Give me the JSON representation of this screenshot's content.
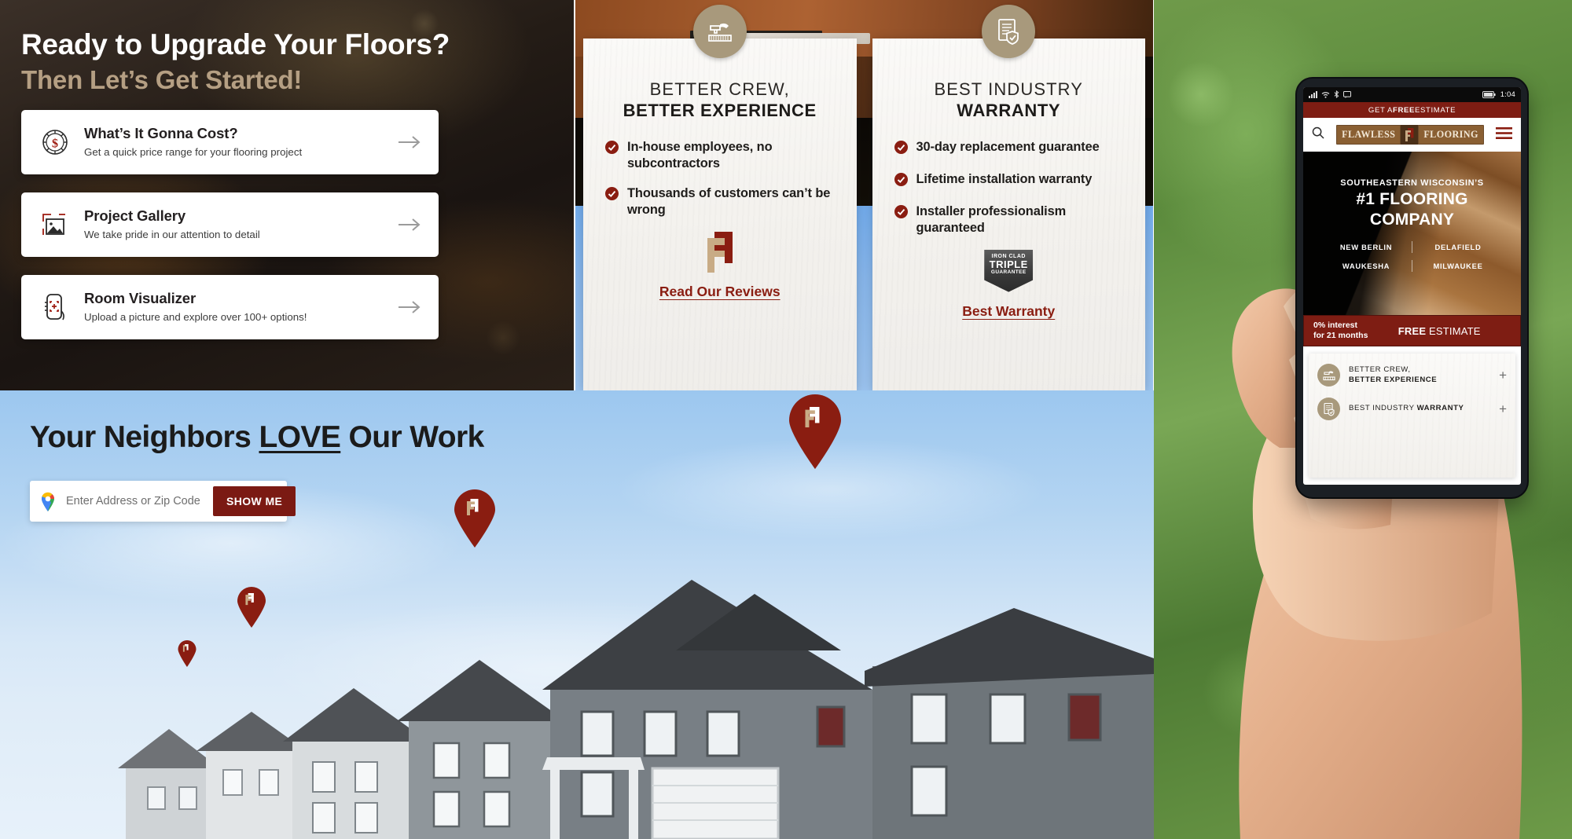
{
  "left_panel": {
    "headline_line1": "Ready to Upgrade Your Floors?",
    "headline_line2": "Then Let’s Get Started!",
    "cards": [
      {
        "icon": "dollar-coin-icon",
        "title": "What’s It Gonna Cost?",
        "subtitle": "Get a quick price range for your flooring project",
        "arrow": "→"
      },
      {
        "icon": "photo-gallery-icon",
        "title": "Project Gallery",
        "subtitle": "We take pride in our attention to detail",
        "arrow": "→"
      },
      {
        "icon": "room-scan-phone-icon",
        "title": "Room Visualizer",
        "subtitle": "Upload a picture and explore over 100+ options!",
        "arrow": "→"
      }
    ]
  },
  "feature_cards": [
    {
      "badge_icon": "hammer-flooring-icon",
      "heading_light": "BETTER CREW,",
      "heading_bold": "BETTER EXPERIENCE",
      "bullets": [
        "In-house employees, no subcontractors",
        "Thousands of customers can’t be wrong"
      ],
      "emblem": "flawless-flooring-f-logo",
      "link": "Read Our Reviews"
    },
    {
      "badge_icon": "certificate-shield-icon",
      "heading_light": "BEST INDUSTRY",
      "heading_bold": "WARRANTY",
      "bullets": [
        "30-day replacement guarantee",
        "Lifetime installation warranty",
        "Installer professionalism guaranteed"
      ],
      "emblem": "iron-clad-triple-guarantee-badge",
      "emblem_line1": "IRON CLAD",
      "emblem_line2": "TRIPLE",
      "emblem_line3": "GUARANTEE",
      "link": "Best Warranty"
    }
  ],
  "neighbors": {
    "title_before": "Your Neighbors ",
    "title_underlined": "LOVE",
    "title_after": " Our Work",
    "search_placeholder": "Enter Address or Zip Code",
    "search_value": "",
    "search_icon": "google-maps-pin-icon",
    "button_label": "SHOW ME",
    "pin_count": 4
  },
  "phone": {
    "status_bar": {
      "time": "1:04",
      "icons": [
        "signal-icon",
        "wifi-icon",
        "bluetooth-icon",
        "message-icon",
        "battery-icon"
      ]
    },
    "top_bar": {
      "prefix": "GET A ",
      "emphasis": "FREE",
      "suffix": " ESTIMATE"
    },
    "nav": {
      "search_icon": "search-icon",
      "menu_icon": "hamburger-menu-icon",
      "logo_left": "FLAWLESS",
      "logo_right": "FLOORING",
      "logo_mark": "ff-monogram-icon"
    },
    "hero": {
      "subtitle": "SOUTHEASTERN WISCONSIN’S",
      "title_line1": "#1 FLOORING",
      "title_line2": "COMPANY",
      "cities": [
        [
          "NEW BERLIN",
          "DELAFIELD"
        ],
        [
          "WAUKESHA",
          "MILWAUKEE"
        ]
      ]
    },
    "promo": {
      "left_line1": "0% interest",
      "left_line2": "for 21 months",
      "right_bold": "FREE",
      "right_rest": " ESTIMATE"
    },
    "accordion": [
      {
        "icon": "hammer-flooring-icon",
        "line1": "BETTER CREW,",
        "line2": "BETTER EXPERIENCE",
        "expander": "+"
      },
      {
        "icon": "certificate-shield-icon",
        "line1": "BEST INDUSTRY ",
        "line2": "WARRANTY",
        "expander": "+"
      }
    ]
  },
  "colors": {
    "brand_red": "#7e1d13",
    "brand_tan": "#a8997c",
    "link_red": "#8a1d11",
    "headline_tan": "#b59f83"
  }
}
